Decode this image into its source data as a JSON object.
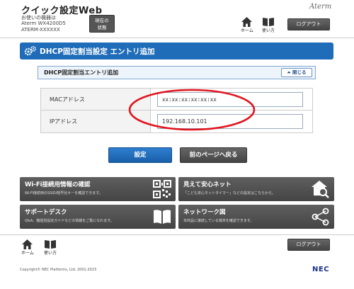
{
  "header": {
    "app_title": "クイック設定Web",
    "device_caption": "お使いの機器は",
    "device_model": "Aterm WX4200D5",
    "device_name": "ATERM-XXXXXX",
    "status_button_line1": "現在の",
    "status_button_line2": "状態",
    "brand": "Aterm",
    "home_label": "ホーム",
    "help_label": "使い方",
    "logout_label": "ログアウト"
  },
  "page": {
    "title": "DHCP固定割当設定 エントリ追加",
    "section_title": "DHCP固定割当エントリ追加",
    "close_label": "閉じる"
  },
  "form": {
    "mac_label": "MACアドレス",
    "mac_value": "xx:xx:xx:xx:xx:xx",
    "ip_label": "IPアドレス",
    "ip_value": "192.168.10.101"
  },
  "actions": {
    "save_label": "設定",
    "back_label": "前のページへ戻る"
  },
  "tiles": [
    {
      "title": "Wi-Fi接続用情報の確認",
      "desc": "Wi-Fi接続用のSSID/暗号化キーを確認できます。",
      "icon": "qr-code-icon"
    },
    {
      "title": "見えて安心ネット",
      "desc": "「こども安心ネットタイマー」などの設定はこちらから。",
      "icon": "home-search-icon"
    },
    {
      "title": "サポートデスク",
      "desc": "Q&A、機能別設定ガイドなどの情報をご覧になれます。",
      "icon": "book-icon"
    },
    {
      "title": "ネットワーク図",
      "desc": "本商品に接続している端末を確認できます。",
      "icon": "network-icon"
    }
  ],
  "footer": {
    "home_label": "ホーム",
    "help_label": "使い方",
    "logout_label": "ログアウト",
    "copyright": "Copyright© NEC Platforms, Ltd. 2001-2023",
    "company": "NEC"
  },
  "colors": {
    "accent_blue": "#1f6db8",
    "tile_gray": "#505050",
    "annotation_red": "#e0141e"
  }
}
